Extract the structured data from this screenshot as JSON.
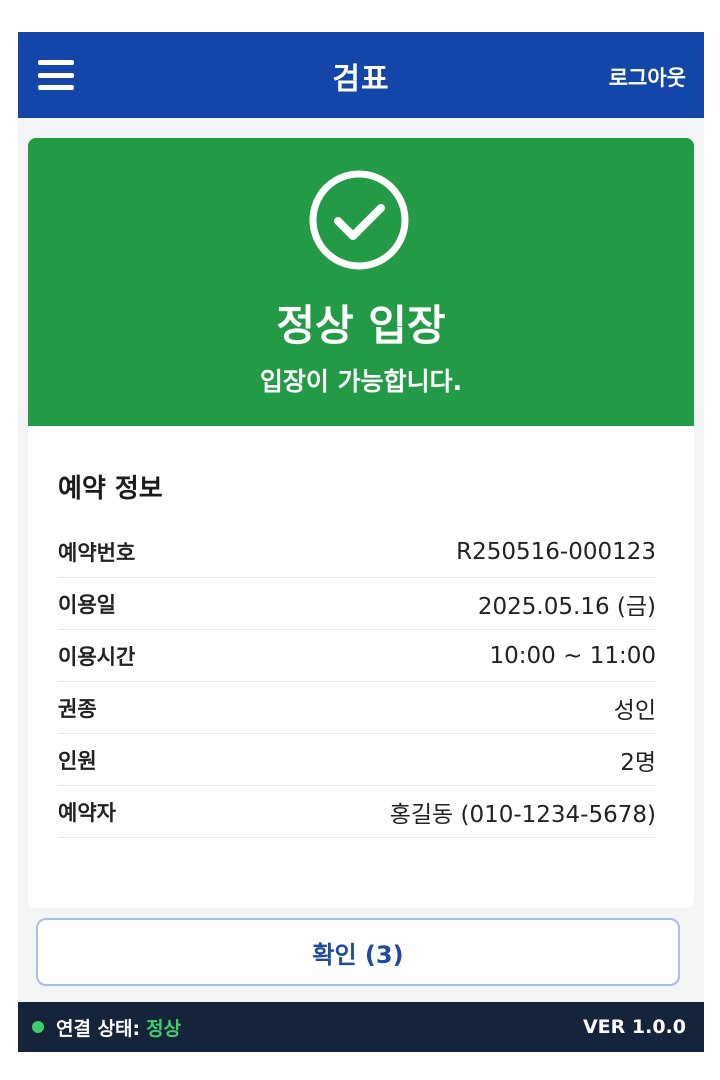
{
  "appbar": {
    "title": "검표",
    "logout_label": "로그아웃"
  },
  "status": {
    "title": "정상 입장",
    "subtitle": "입장이 가능합니다."
  },
  "reservation": {
    "title": "예약 정보",
    "rows": [
      {
        "label": "예약번호",
        "value": "R250516-000123"
      },
      {
        "label": "이용일",
        "value": "2025.05.16 (금)"
      },
      {
        "label": "이용시간",
        "value": "10:00 ~ 11:00"
      },
      {
        "label": "권종",
        "value": "성인"
      },
      {
        "label": "인원",
        "value": "2명"
      },
      {
        "label": "예약자",
        "value": "홍길동 (010-1234-5678)"
      }
    ]
  },
  "confirm_label": "확인 (3)",
  "footer": {
    "connection_label": "연결 상태:",
    "connection_value": "정상",
    "version": "VER 1.0.0"
  },
  "colors": {
    "header": "#1346a8",
    "success": "#239a45",
    "footer": "#15233b",
    "connected": "#3bd16a"
  }
}
